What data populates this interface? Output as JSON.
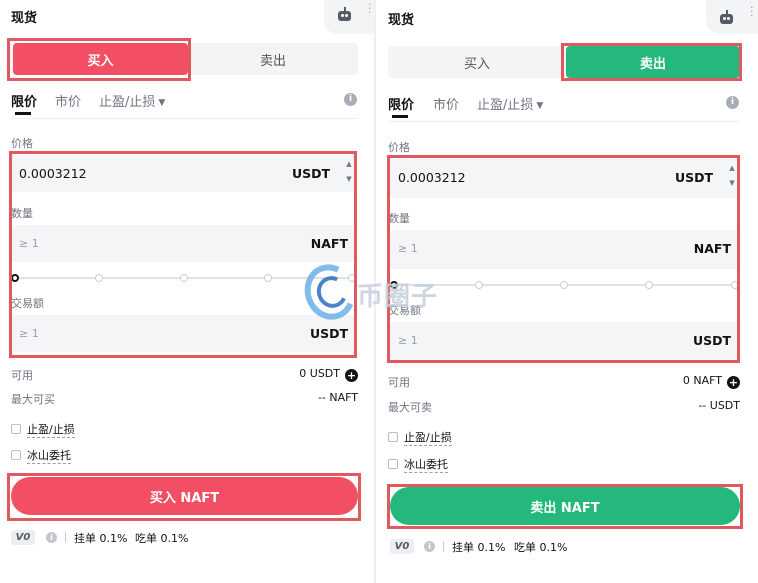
{
  "buy_panel": {
    "title": "现货",
    "tabs": {
      "buy": "买入",
      "sell": "卖出",
      "active": "buy"
    },
    "order_types": [
      "限价",
      "市价",
      "止盈/止损"
    ],
    "price": {
      "label": "价格",
      "value": "0.0003212",
      "unit": "USDT"
    },
    "amount": {
      "label": "数量",
      "placeholder": "≥ 1",
      "unit": "NAFT"
    },
    "total": {
      "label": "交易额",
      "placeholder": "≥ 1",
      "unit": "USDT"
    },
    "available": {
      "label": "可用",
      "value": "0 USDT"
    },
    "max": {
      "label": "最大可买",
      "value": "-- NAFT"
    },
    "options": [
      "止盈/止损",
      "冰山委托"
    ],
    "action_label": "买入 NAFT",
    "fee": {
      "vip": "V0",
      "maker": "挂单 0.1%",
      "taker": "吃单 0.1%"
    },
    "colors": {
      "accent": "#f24f64"
    }
  },
  "sell_panel": {
    "title": "现货",
    "tabs": {
      "buy": "买入",
      "sell": "卖出",
      "active": "sell"
    },
    "order_types": [
      "限价",
      "市价",
      "止盈/止损"
    ],
    "price": {
      "label": "价格",
      "value": "0.0003212",
      "unit": "USDT"
    },
    "amount": {
      "label": "数量",
      "placeholder": "≥ 1",
      "unit": "NAFT"
    },
    "total": {
      "label": "交易额",
      "placeholder": "≥ 1",
      "unit": "USDT"
    },
    "available": {
      "label": "可用",
      "value": "0 NAFT"
    },
    "max": {
      "label": "最大可卖",
      "value": "-- USDT"
    },
    "options": [
      "止盈/止损",
      "冰山委托"
    ],
    "action_label": "卖出 NAFT",
    "fee": {
      "vip": "V0",
      "maker": "挂单 0.1%",
      "taker": "吃单 0.1%"
    },
    "colors": {
      "accent": "#25b87c"
    }
  },
  "icons": {
    "header_bot": "robot-icon",
    "header_menu": "more-vertical-icon",
    "info": "info-icon",
    "add": "plus-circle-icon"
  },
  "watermark": {
    "text": "币圈子"
  },
  "highlight_color": "#e05860"
}
